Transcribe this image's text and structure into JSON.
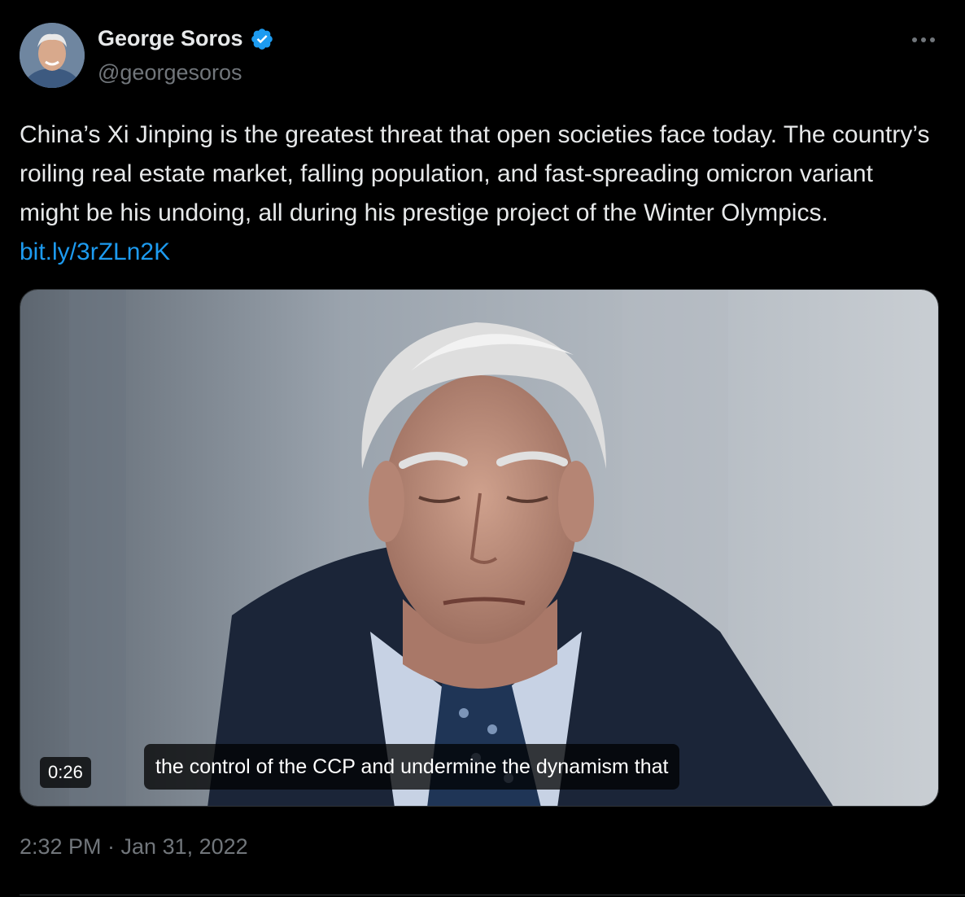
{
  "author": {
    "display_name": "George Soros",
    "handle": "@georgesoros",
    "verified_color": "#1d9bf0"
  },
  "tweet": {
    "text": "China’s Xi Jinping is the greatest threat that open societies face today. The country’s roiling real estate market, falling population, and fast-spreading omicron variant might be his undoing, all during his prestige project of the Winter Olympics. ",
    "link": "bit.ly/3rZLn2K",
    "timestamp": "2:32 PM · Jan 31, 2022"
  },
  "video": {
    "duration": "0:26",
    "caption": "the control of the CCP and undermine the dynamism that"
  },
  "colors": {
    "background": "#000000",
    "text": "#e7e9ea",
    "secondary_text": "#71767b",
    "link": "#1d9bf0"
  },
  "icons": {
    "verified": "verified-badge-icon",
    "more": "more-horizontal-icon"
  }
}
